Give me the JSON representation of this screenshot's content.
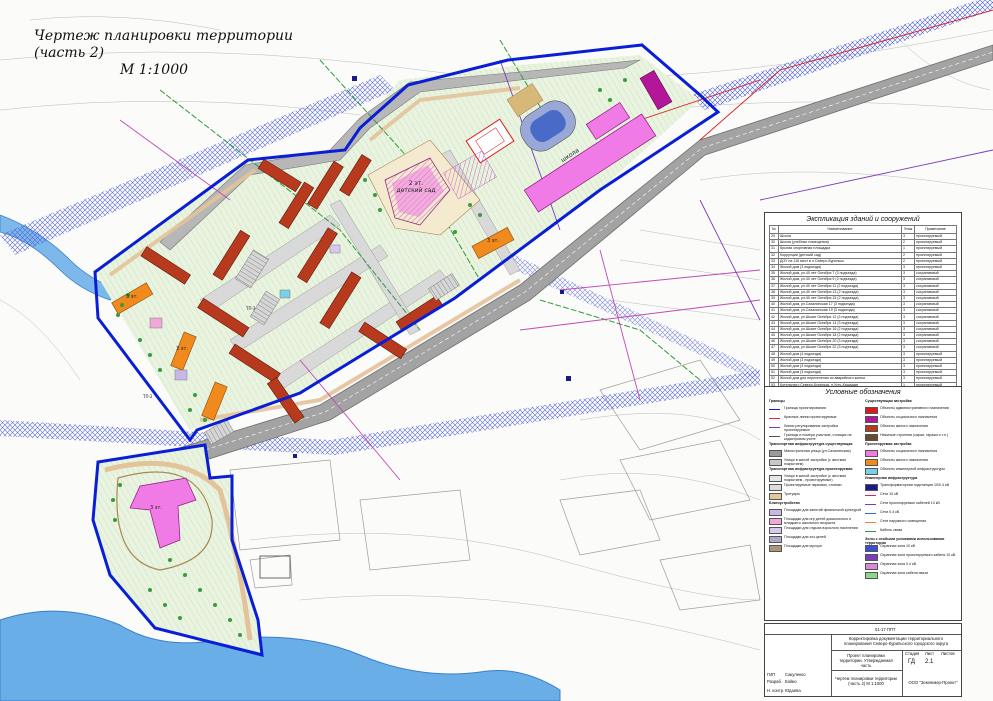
{
  "drawing": {
    "title": "Чертеж планировки территории (часть 2)",
    "scale": "М 1:1000"
  },
  "map_labels": {
    "kindergarten": "2 эт. детский сад",
    "school": "школа",
    "bldg_3et": "3 эт.",
    "bldg_3et_b": "3 эт.",
    "bldg_3et_c": "3 эт.",
    "bldg_3et_d": "3 эт.",
    "ts1": "ТП-3",
    "ts2": "ТП-2"
  },
  "colors": {
    "boundary": "#0a1ed6",
    "road": "#9a9a9a",
    "residential_new": "#b83a1e",
    "residential_orange": "#f08a1c",
    "school_pink": "#f07ae6",
    "social_magenta": "#b4169a",
    "river": "#5aa3e6",
    "hatch": "#3b4fd0",
    "greenery": "#2f9b3a"
  },
  "explication": {
    "title": "Экспликация зданий и сооружений",
    "headers": [
      "№",
      "Наименование",
      "Этаж",
      "Примечание"
    ],
    "rows": [
      [
        "29",
        "Школа",
        "3",
        "проектируемый"
      ],
      [
        "30",
        "Школа (учебные помещения)",
        "2",
        "проектируемый"
      ],
      [
        "31",
        "Крытая спортивная площадка",
        "1",
        "проектируемый"
      ],
      [
        "32",
        "Коррупции (детский сад)",
        "2",
        "проектируемый"
      ],
      [
        "33",
        "ДОУ на 116 мест в п.Северо-Курильск",
        "2",
        "проектируемый"
      ],
      [
        "34",
        "Жилой дом (3 подъезда)",
        "3",
        "проектируемый"
      ],
      [
        "35",
        "Жилой дом, ул.40 лет Октября 7 (3 подъезда)",
        "3",
        "сохраняемый"
      ],
      [
        "36",
        "Жилой дом, ул.40 лет Октября 9 (2 подъезда)",
        "3",
        "сохраняемый"
      ],
      [
        "37",
        "Жилой дом, ул.40 лет Октября 11 (2 подъезда)",
        "3",
        "сохраняемый"
      ],
      [
        "38",
        "Жилой дом, ул.40 лет Октября 13 (2 подъезда)",
        "3",
        "сохраняемый"
      ],
      [
        "39",
        "Жилой дом, ул.40 лет Октября 15 (2 подъезда)",
        "3",
        "сохраняемый"
      ],
      [
        "40",
        "Жилой дом, ул.Сахалинская 17 (3 подъезда)",
        "3",
        "сохраняемый"
      ],
      [
        "41",
        "Жилой дом, ул.Сахалинская 19 (3 подъезда)",
        "3",
        "сохраняемый"
      ],
      [
        "42",
        "Жилой дом, ул.Шкаят Октября 12 (3 подъезда)",
        "3",
        "сохраняемый"
      ],
      [
        "43",
        "Жилой дом, ул.Шкаят Октября 14 (3 подъезда)",
        "3",
        "сохраняемый"
      ],
      [
        "44",
        "Жилой дом, ул.Шкаят Октября 16 (2 подъезда)",
        "3",
        "сохраняемый"
      ],
      [
        "45",
        "Жилой дом, ул.Шкаят Октября 18 (2 подъезда)",
        "3",
        "сохраняемый"
      ],
      [
        "46",
        "Жилой дом, ул.Шкаят Октября 20 (3 подъезда)",
        "3",
        "сохраняемый"
      ],
      [
        "47",
        "Жилой дом, ул.Шкаят Октября 22 (3 подъезда)",
        "3",
        "сохраняемый"
      ],
      [
        "48",
        "Жилой дом (4 подъезда)",
        "3",
        "проектируемый"
      ],
      [
        "49",
        "Жилой дом (3 подъезда)",
        "3",
        "проектируемый"
      ],
      [
        "50",
        "Жилой дом (3 подъезда)",
        "3",
        "проектируемый"
      ],
      [
        "51",
        "Жилой дом (3 подъезда)",
        "3",
        "проектируемый"
      ],
      [
        "52",
        "Жилой дом для переселения из аварийного жилья",
        "3",
        "проектируемый"
      ],
      [
        "53",
        "Котельная г.Северо-Курильск, п.Усть-Кишадын",
        "1",
        "проектируемый"
      ],
      [
        "54",
        "Магазин",
        "1",
        "проектируемый"
      ],
      [
        "55",
        "Трансформаторная подстанция",
        "1",
        "проектируемый"
      ]
    ]
  },
  "legend": {
    "title": "Условные обозначения",
    "left": [
      {
        "text": "Границы",
        "header": true
      },
      {
        "text": "Граница проектирования",
        "color": "#0a1ed6",
        "kind": "line"
      },
      {
        "text": "Красные линии проектируемые",
        "color": "#e0245a",
        "kind": "line"
      },
      {
        "text": "Линии регулирования застройки проектируемые",
        "color": "#7a3bbd",
        "kind": "line"
      },
      {
        "text": "Границы и номера участков, стоящих на кадастровом учете",
        "color": "#555555",
        "kind": "line"
      },
      {
        "text": "Транспортная инфраструктура существующая",
        "header": true
      },
      {
        "text": "Магистральная улица (ул.Сахалинская)",
        "color": "#9a9a9a",
        "kind": "fill"
      },
      {
        "text": "Улицы в жилой застройке (с жестким покрытием)",
        "color": "#c8c8c8",
        "kind": "fill"
      },
      {
        "text": "Транспортная инфраструктура проектируемая",
        "header": true
      },
      {
        "text": "Улицы в жилой застройке (с жестким покрытием - проектируемые)",
        "color": "#e6e6e6",
        "kind": "fill"
      },
      {
        "text": "Проектируемые парковки, стоянки",
        "color": "#dcdcdc",
        "kind": "fill"
      },
      {
        "text": "Тротуары",
        "color": "#e3c89a",
        "kind": "fill"
      },
      {
        "text": "Благоустройство",
        "header": true
      },
      {
        "text": "Площадки для занятий физической культурой",
        "color": "#c8b8e8",
        "kind": "fill"
      },
      {
        "text": "Площадки для игр детей дошкольного и младшего школьного возраста",
        "color": "#f0a8d8",
        "kind": "fill"
      },
      {
        "text": "Площадки для отдыха взрослого населения",
        "color": "#d8c8f0",
        "kind": "fill"
      },
      {
        "text": "Площадки для хоз.целей",
        "color": "#b0a8c8",
        "kind": "fill"
      },
      {
        "text": "Площадки для мусора",
        "color": "#a89878",
        "kind": "fill"
      }
    ],
    "right": [
      {
        "text": "Существующая застройка",
        "header": true
      },
      {
        "text": "Объекты административного назначения",
        "color": "#d81b1b",
        "kind": "fill"
      },
      {
        "text": "Объекты социального назначения",
        "color": "#b4169a",
        "kind": "fill"
      },
      {
        "text": "Объекты жилого назначения",
        "color": "#b83a1e",
        "kind": "fill"
      },
      {
        "text": "Нежилые строения (сараи, гаражи и т.п.)",
        "color": "#6b4a2a",
        "kind": "fill"
      },
      {
        "text": "Проектируемая застройка",
        "header": true
      },
      {
        "text": "Объекты социального назначения",
        "color": "#f07ae6",
        "kind": "fill"
      },
      {
        "text": "Объекты жилого назначения",
        "color": "#f08a1c",
        "kind": "fill"
      },
      {
        "text": "Объекты инженерной инфраструктуры",
        "color": "#7ad0e6",
        "kind": "fill"
      },
      {
        "text": "Инженерная инфраструктура",
        "header": true
      },
      {
        "text": "Трансформаторная подстанция 10/0.4 кВ",
        "color": "#1a1a8a",
        "kind": "fill"
      },
      {
        "text": "Сети 10 кВ",
        "color": "#e0245a",
        "kind": "line"
      },
      {
        "text": "Сети проектируемые кабелей 10 кВ",
        "color": "#7a3bbd",
        "kind": "line"
      },
      {
        "text": "Сети 0.4 кВ",
        "color": "#3b6ad0",
        "kind": "line"
      },
      {
        "text": "Сети наружного освещения",
        "color": "#f08a1c",
        "kind": "line"
      },
      {
        "text": "Кабель связи",
        "color": "#2f9b3a",
        "kind": "line"
      },
      {
        "text": "Зоны с особыми условиями использования территории",
        "header": true
      },
      {
        "text": "Охранная зона 10 кВ",
        "color": "#3b4fd0",
        "kind": "fill"
      },
      {
        "text": "Охранная зона проектируемого кабеля 10 кВ",
        "color": "#7a3bbd",
        "kind": "fill"
      },
      {
        "text": "Охранная зона 0.4 кВ",
        "color": "#d88ad8",
        "kind": "fill"
      },
      {
        "text": "Охранная зона кабеля связи",
        "color": "#8ad88a",
        "kind": "fill"
      }
    ]
  },
  "stamp": {
    "code": "01-17 ППТ",
    "org_title": "Корректировка документации территориального планирования Северо-Курильского городского округа",
    "section": "Проект планировки территории. Утверждаемая часть",
    "sheet_title": "Чертеж планировки территории (часть 2) М 1:1000",
    "stage_label": "Стадия",
    "sheet_label": "Лист",
    "sheets_label": "Листов",
    "stage": "ГД",
    "sheet": "2.1",
    "company": "ООО \"Землемер-Проект\"",
    "roles": [
      "ГИП",
      "Разраб.",
      "Н. контр."
    ],
    "names": [
      "Сакуленко",
      "Бойко",
      "Юдаева"
    ]
  }
}
